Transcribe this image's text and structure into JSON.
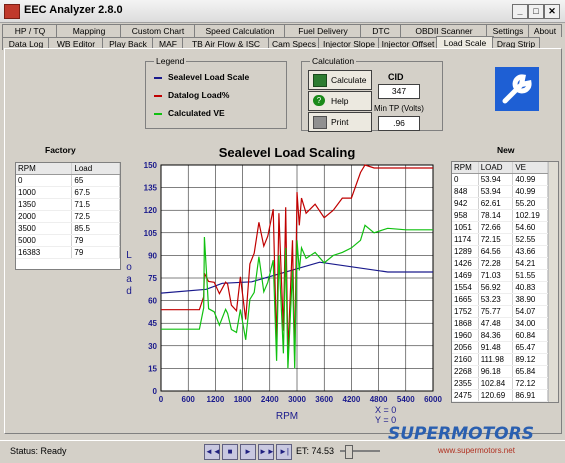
{
  "window": {
    "title": "EEC Analyzer 2.8.0"
  },
  "tabs_row1": [
    "HP / TQ",
    "Mapping",
    "Custom Chart",
    "Speed Calculation",
    "Fuel Delivery",
    "DTC",
    "OBDII Scanner",
    "Settings",
    "About"
  ],
  "tabs_row2": [
    "Data Log",
    "WB Editor",
    "Play Back",
    "MAF",
    "TB Air Flow & ISC",
    "Cam Specs",
    "Injector Slope",
    "Injector Offset",
    "Load Scale",
    "Drag Strip"
  ],
  "active_tab": "Load Scale",
  "legend": {
    "title": "Legend",
    "items": [
      {
        "label": "Sealevel Load Scale",
        "color": "#1a1a8c"
      },
      {
        "label": "Datalog Load%",
        "color": "#c00000"
      },
      {
        "label": "Calculated VE",
        "color": "#10c010"
      }
    ]
  },
  "calculation": {
    "title": "Calculation",
    "calculate_label": "Calculate",
    "help_label": "Help",
    "print_label": "Print",
    "cid_label": "CID",
    "cid_value": "347",
    "min_tp_label": "Min TP (Volts)",
    "min_tp_value": ".96"
  },
  "factory": {
    "title": "Factory",
    "headers": [
      "RPM",
      "Load"
    ],
    "rows": [
      [
        "0",
        "65"
      ],
      [
        "1000",
        "67.5"
      ],
      [
        "1350",
        "71.5"
      ],
      [
        "2000",
        "72.5"
      ],
      [
        "3500",
        "85.5"
      ],
      [
        "5000",
        "79"
      ],
      [
        "16383",
        "79"
      ]
    ]
  },
  "new_table": {
    "title": "New",
    "headers": [
      "RPM",
      "LOAD",
      "VE"
    ],
    "rows": [
      [
        "0",
        "53.94",
        "40.99"
      ],
      [
        "848",
        "53.94",
        "40.99"
      ],
      [
        "942",
        "62.61",
        "55.20"
      ],
      [
        "958",
        "78.14",
        "102.19"
      ],
      [
        "1051",
        "72.66",
        "54.60"
      ],
      [
        "1174",
        "72.15",
        "52.55"
      ],
      [
        "1289",
        "64.56",
        "43.66"
      ],
      [
        "1426",
        "72.28",
        "54.21"
      ],
      [
        "1469",
        "71.03",
        "51.55"
      ],
      [
        "1554",
        "56.92",
        "40.83"
      ],
      [
        "1665",
        "53.23",
        "38.90"
      ],
      [
        "1752",
        "75.77",
        "54.07"
      ],
      [
        "1868",
        "47.48",
        "34.00"
      ],
      [
        "1960",
        "84.36",
        "60.84"
      ],
      [
        "2056",
        "91.48",
        "65.47"
      ],
      [
        "2160",
        "111.98",
        "89.12"
      ],
      [
        "2268",
        "96.18",
        "65.84"
      ],
      [
        "2355",
        "102.84",
        "72.12"
      ],
      [
        "2475",
        "120.69",
        "86.91"
      ]
    ]
  },
  "chart_data": {
    "type": "line",
    "title": "Sealevel Load Scaling",
    "xlabel": "RPM",
    "ylabel": "Load",
    "xlim": [
      0,
      6000
    ],
    "ylim": [
      0,
      150
    ],
    "xticks": [
      0,
      600,
      1200,
      1800,
      2400,
      3000,
      3600,
      4200,
      4800,
      5400,
      6000
    ],
    "yticks": [
      0,
      15,
      30,
      45,
      60,
      75,
      90,
      105,
      120,
      135,
      150
    ],
    "grid": true,
    "series": [
      {
        "name": "Sealevel Load Scale",
        "color": "#1a1a8c",
        "x": [
          0,
          1000,
          1350,
          2000,
          3500,
          5000,
          6000
        ],
        "y": [
          65,
          67.5,
          71.5,
          72.5,
          85.5,
          79,
          79
        ]
      },
      {
        "name": "Datalog Load%",
        "color": "#c00000",
        "x": [
          0,
          848,
          942,
          958,
          1051,
          1174,
          1289,
          1426,
          1469,
          1554,
          1665,
          1752,
          1868,
          1960,
          2056,
          2160,
          2268,
          2355,
          2475,
          2550,
          2600,
          2700,
          2750,
          2800,
          2900,
          2950,
          3000,
          3050,
          3100,
          3200,
          3400,
          3600,
          3800,
          4000,
          4200,
          4400,
          4500,
          4700,
          5000,
          5400,
          6000
        ],
        "y": [
          53.94,
          53.94,
          62.61,
          78.14,
          72.66,
          72.15,
          64.56,
          72.28,
          71.03,
          56.92,
          53.23,
          75.77,
          47.48,
          84.36,
          91.48,
          111.98,
          96.18,
          102.84,
          120.69,
          30,
          118,
          40,
          122,
          25,
          100,
          20,
          132,
          110,
          128,
          118,
          124,
          115,
          120,
          128,
          128,
          145,
          150,
          148,
          148,
          148,
          148
        ]
      },
      {
        "name": "Calculated VE",
        "color": "#10c010",
        "x": [
          0,
          848,
          942,
          958,
          1051,
          1174,
          1289,
          1426,
          1469,
          1554,
          1665,
          1752,
          1868,
          1960,
          2056,
          2160,
          2268,
          2355,
          2475,
          2550,
          2600,
          2700,
          2750,
          2800,
          2900,
          2950,
          3000,
          3050,
          3100,
          3200,
          3400,
          3600,
          3800,
          4000,
          4200,
          4400,
          4500,
          4700,
          5000,
          5400,
          6000
        ],
        "y": [
          40.99,
          40.99,
          55.2,
          102.19,
          54.6,
          52.55,
          43.66,
          54.21,
          51.55,
          40.83,
          38.9,
          54.07,
          34.0,
          60.84,
          65.47,
          89.12,
          65.84,
          72.12,
          86.91,
          20,
          90,
          25,
          95,
          15,
          80,
          15,
          100,
          80,
          95,
          88,
          92,
          85,
          90,
          92,
          95,
          100,
          110,
          105,
          108,
          107,
          107
        ]
      }
    ],
    "coord_x_label": "X = 0",
    "coord_y_label": "Y = 0"
  },
  "status": {
    "text": "Status: Ready",
    "et_label": "ET: 74.53",
    "nav": [
      "◄◄",
      "■",
      "►",
      "►►",
      "►|"
    ]
  },
  "watermark": {
    "brand": "SUPERMOTORS",
    "url": "www.supermotors.net"
  },
  "colors": {
    "wrench_tile": "#1e5fd4"
  }
}
